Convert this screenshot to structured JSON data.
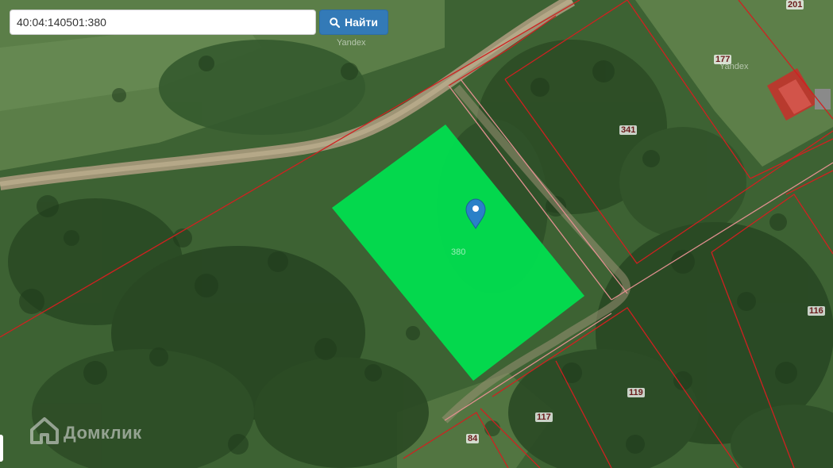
{
  "search": {
    "value": "40:04:140501:380",
    "button_label": "Найти"
  },
  "attribution": {
    "top": "Yandex",
    "right": "Yandex"
  },
  "brand": {
    "text": "Домклик"
  },
  "parcels": {
    "selected": "380",
    "labels": [
      "201",
      "177",
      "341",
      "116",
      "119",
      "117",
      "84"
    ]
  },
  "colors": {
    "selected_fill": "#00e150",
    "boundary": "#d02020",
    "button": "#337ab7",
    "marker": "#2a80c8"
  },
  "icons": {
    "search": "search-icon",
    "marker": "map-pin-icon",
    "brand": "house-logo-icon"
  }
}
